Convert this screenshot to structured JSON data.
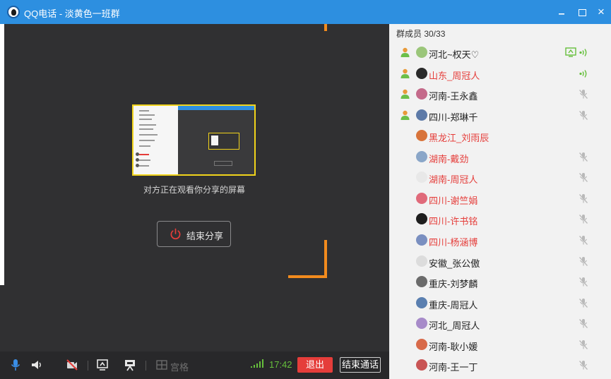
{
  "titlebar": {
    "title": "QQ电话 - 淡黄色一班群",
    "close_symbol": "×"
  },
  "main": {
    "share_status": "对方正在观看你分享的屏幕",
    "end_share_label": "结束分享"
  },
  "toolbar": {
    "grid_label": "宫格",
    "time": "17:42",
    "exit_label": "退出",
    "end_call_label": "结束通话"
  },
  "members": {
    "title": "群成员 30/33",
    "list": [
      {
        "name": "河北~权天♡",
        "color": "#222222",
        "has_user_icon": true,
        "avatar": "#9bc67a",
        "mic": "active",
        "sharing": true
      },
      {
        "name": "山东_周冠人",
        "color": "#e53d3a",
        "has_user_icon": true,
        "avatar": "#2a2a2a",
        "mic": "active"
      },
      {
        "name": "河南-王永鑫",
        "color": "#222222",
        "has_user_icon": true,
        "avatar": "#c46a8a",
        "mic": "muted"
      },
      {
        "name": "四川-郑琳千",
        "color": "#222222",
        "has_user_icon": true,
        "avatar": "#5d7aa8",
        "mic": "muted"
      },
      {
        "name": "黑龙江_刘雨辰",
        "color": "#e53d3a",
        "has_user_icon": false,
        "avatar": "#d8743b",
        "mic": "none"
      },
      {
        "name": "湖南-戴劲",
        "color": "#e53d3a",
        "has_user_icon": false,
        "avatar": "#8aa6c8",
        "mic": "muted"
      },
      {
        "name": "湖南-周冠人",
        "color": "#e53d3a",
        "has_user_icon": false,
        "avatar": "#e8e8e8",
        "mic": "muted"
      },
      {
        "name": "四川-谢竺娟",
        "color": "#e53d3a",
        "has_user_icon": false,
        "avatar": "#e06a7a",
        "mic": "muted"
      },
      {
        "name": "四川-许书铭",
        "color": "#e53d3a",
        "has_user_icon": false,
        "avatar": "#1e1e1e",
        "mic": "muted"
      },
      {
        "name": "四川-杨涵博",
        "color": "#e53d3a",
        "has_user_icon": false,
        "avatar": "#7a8fc0",
        "mic": "muted"
      },
      {
        "name": "安徽_张公傲",
        "color": "#222222",
        "has_user_icon": false,
        "avatar": "#dcdcdc",
        "mic": "muted"
      },
      {
        "name": "重庆-刘梦麟",
        "color": "#222222",
        "has_user_icon": false,
        "avatar": "#6b6b6b",
        "mic": "muted"
      },
      {
        "name": "重庆-周冠人",
        "color": "#222222",
        "has_user_icon": false,
        "avatar": "#5a7fb0",
        "mic": "muted"
      },
      {
        "name": "河北_周冠人",
        "color": "#222222",
        "has_user_icon": false,
        "avatar": "#a78bc9",
        "mic": "muted"
      },
      {
        "name": "河南-耿小媛",
        "color": "#222222",
        "has_user_icon": false,
        "avatar": "#d86a4a",
        "mic": "muted"
      },
      {
        "name": "河南-王一丁",
        "color": "#222222",
        "has_user_icon": false,
        "avatar": "#c95555",
        "mic": "muted"
      }
    ]
  },
  "colors": {
    "titlebar": "#2d8fe0",
    "accent_orange": "#f28b1e",
    "exit_red": "#e53d3a",
    "signal_green": "#66bf3c",
    "preview_border": "#f1d31b"
  }
}
